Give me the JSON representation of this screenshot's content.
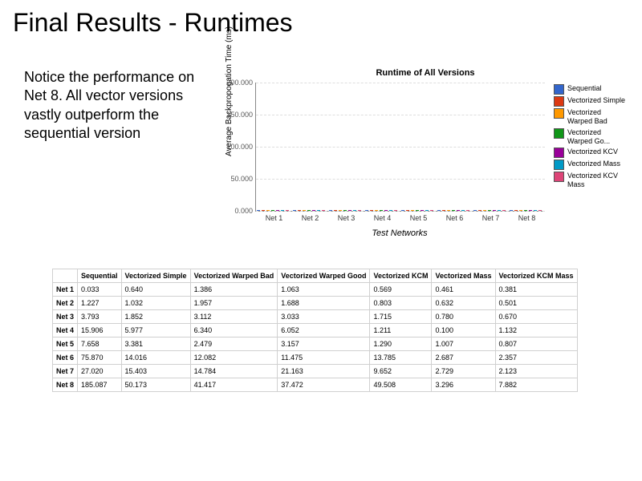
{
  "title": "Final Results - Runtimes",
  "note": "Notice the performance on Net 8.  All vector versions vastly outperform the sequential version",
  "chart_data": {
    "type": "bar",
    "title": "Runtime of All Versions",
    "xlabel": "Test Networks",
    "ylabel": "Average Backpropogation Time (ms)",
    "ylim": [
      0,
      200000
    ],
    "yticks": [
      0,
      50000,
      100000,
      150000,
      200000
    ],
    "yticklabels": [
      "0.000",
      "50.000",
      "100.000",
      "150.000",
      "200.000"
    ],
    "categories": [
      "Net 1",
      "Net 2",
      "Net 3",
      "Net 4",
      "Net 5",
      "Net 6",
      "Net 7",
      "Net 8"
    ],
    "series": [
      {
        "name": "Sequential",
        "color": "#3366cc",
        "values": [
          0.033,
          1.227,
          3.793,
          15.906,
          7.658,
          75.87,
          27.02,
          185.087
        ]
      },
      {
        "name": "Vectorized Simple",
        "color": "#dc3912",
        "values": [
          0.64,
          1.032,
          1.852,
          5.977,
          3.381,
          14.016,
          15.403,
          50.173
        ]
      },
      {
        "name": "Vectorized Warped Bad",
        "color": "#ff9900",
        "values": [
          1.386,
          1.957,
          3.112,
          6.34,
          2.479,
          12.082,
          14.784,
          41.417
        ]
      },
      {
        "name": "Vectorized Warped Go...",
        "color": "#109618",
        "values": [
          1.063,
          1.688,
          3.033,
          6.052,
          3.157,
          11.475,
          21.163,
          37.472
        ]
      },
      {
        "name": "Vectorized KCV",
        "color": "#990099",
        "values": [
          0.569,
          0.803,
          1.715,
          1.211,
          1.29,
          13.785,
          9.652,
          49.508
        ]
      },
      {
        "name": "Vectorized Mass",
        "color": "#0099c6",
        "values": [
          0.461,
          0.632,
          0.78,
          0.1,
          1.007,
          2.687,
          2.729,
          3.296
        ]
      },
      {
        "name": "Vectorized KCV Mass",
        "color": "#dd4477",
        "values": [
          0.381,
          0.501,
          0.67,
          1.132,
          0.807,
          2.357,
          2.123,
          7.882
        ]
      }
    ]
  },
  "table": {
    "headers": [
      "",
      "Sequential",
      "Vectorized Simple",
      "Vectorized Warped Bad",
      "Vectorized Warped Good",
      "Vectorized KCM",
      "Vectorized Mass",
      "Vectorized KCM Mass"
    ],
    "rows": [
      [
        "Net 1",
        "0.033",
        "0.640",
        "1.386",
        "1.063",
        "0.569",
        "0.461",
        "0.381"
      ],
      [
        "Net 2",
        "1.227",
        "1.032",
        "1.957",
        "1.688",
        "0.803",
        "0.632",
        "0.501"
      ],
      [
        "Net 3",
        "3.793",
        "1.852",
        "3.112",
        "3.033",
        "1.715",
        "0.780",
        "0.670"
      ],
      [
        "Net 4",
        "15.906",
        "5.977",
        "6.340",
        "6.052",
        "1.211",
        "0.100",
        "1.132"
      ],
      [
        "Net 5",
        "7.658",
        "3.381",
        "2.479",
        "3.157",
        "1.290",
        "1.007",
        "0.807"
      ],
      [
        "Net 6",
        "75.870",
        "14.016",
        "12.082",
        "11.475",
        "13.785",
        "2.687",
        "2.357"
      ],
      [
        "Net 7",
        "27.020",
        "15.403",
        "14.784",
        "21.163",
        "9.652",
        "2.729",
        "2.123"
      ],
      [
        "Net 8",
        "185.087",
        "50.173",
        "41.417",
        "37.472",
        "49.508",
        "3.296",
        "7.882"
      ]
    ]
  }
}
